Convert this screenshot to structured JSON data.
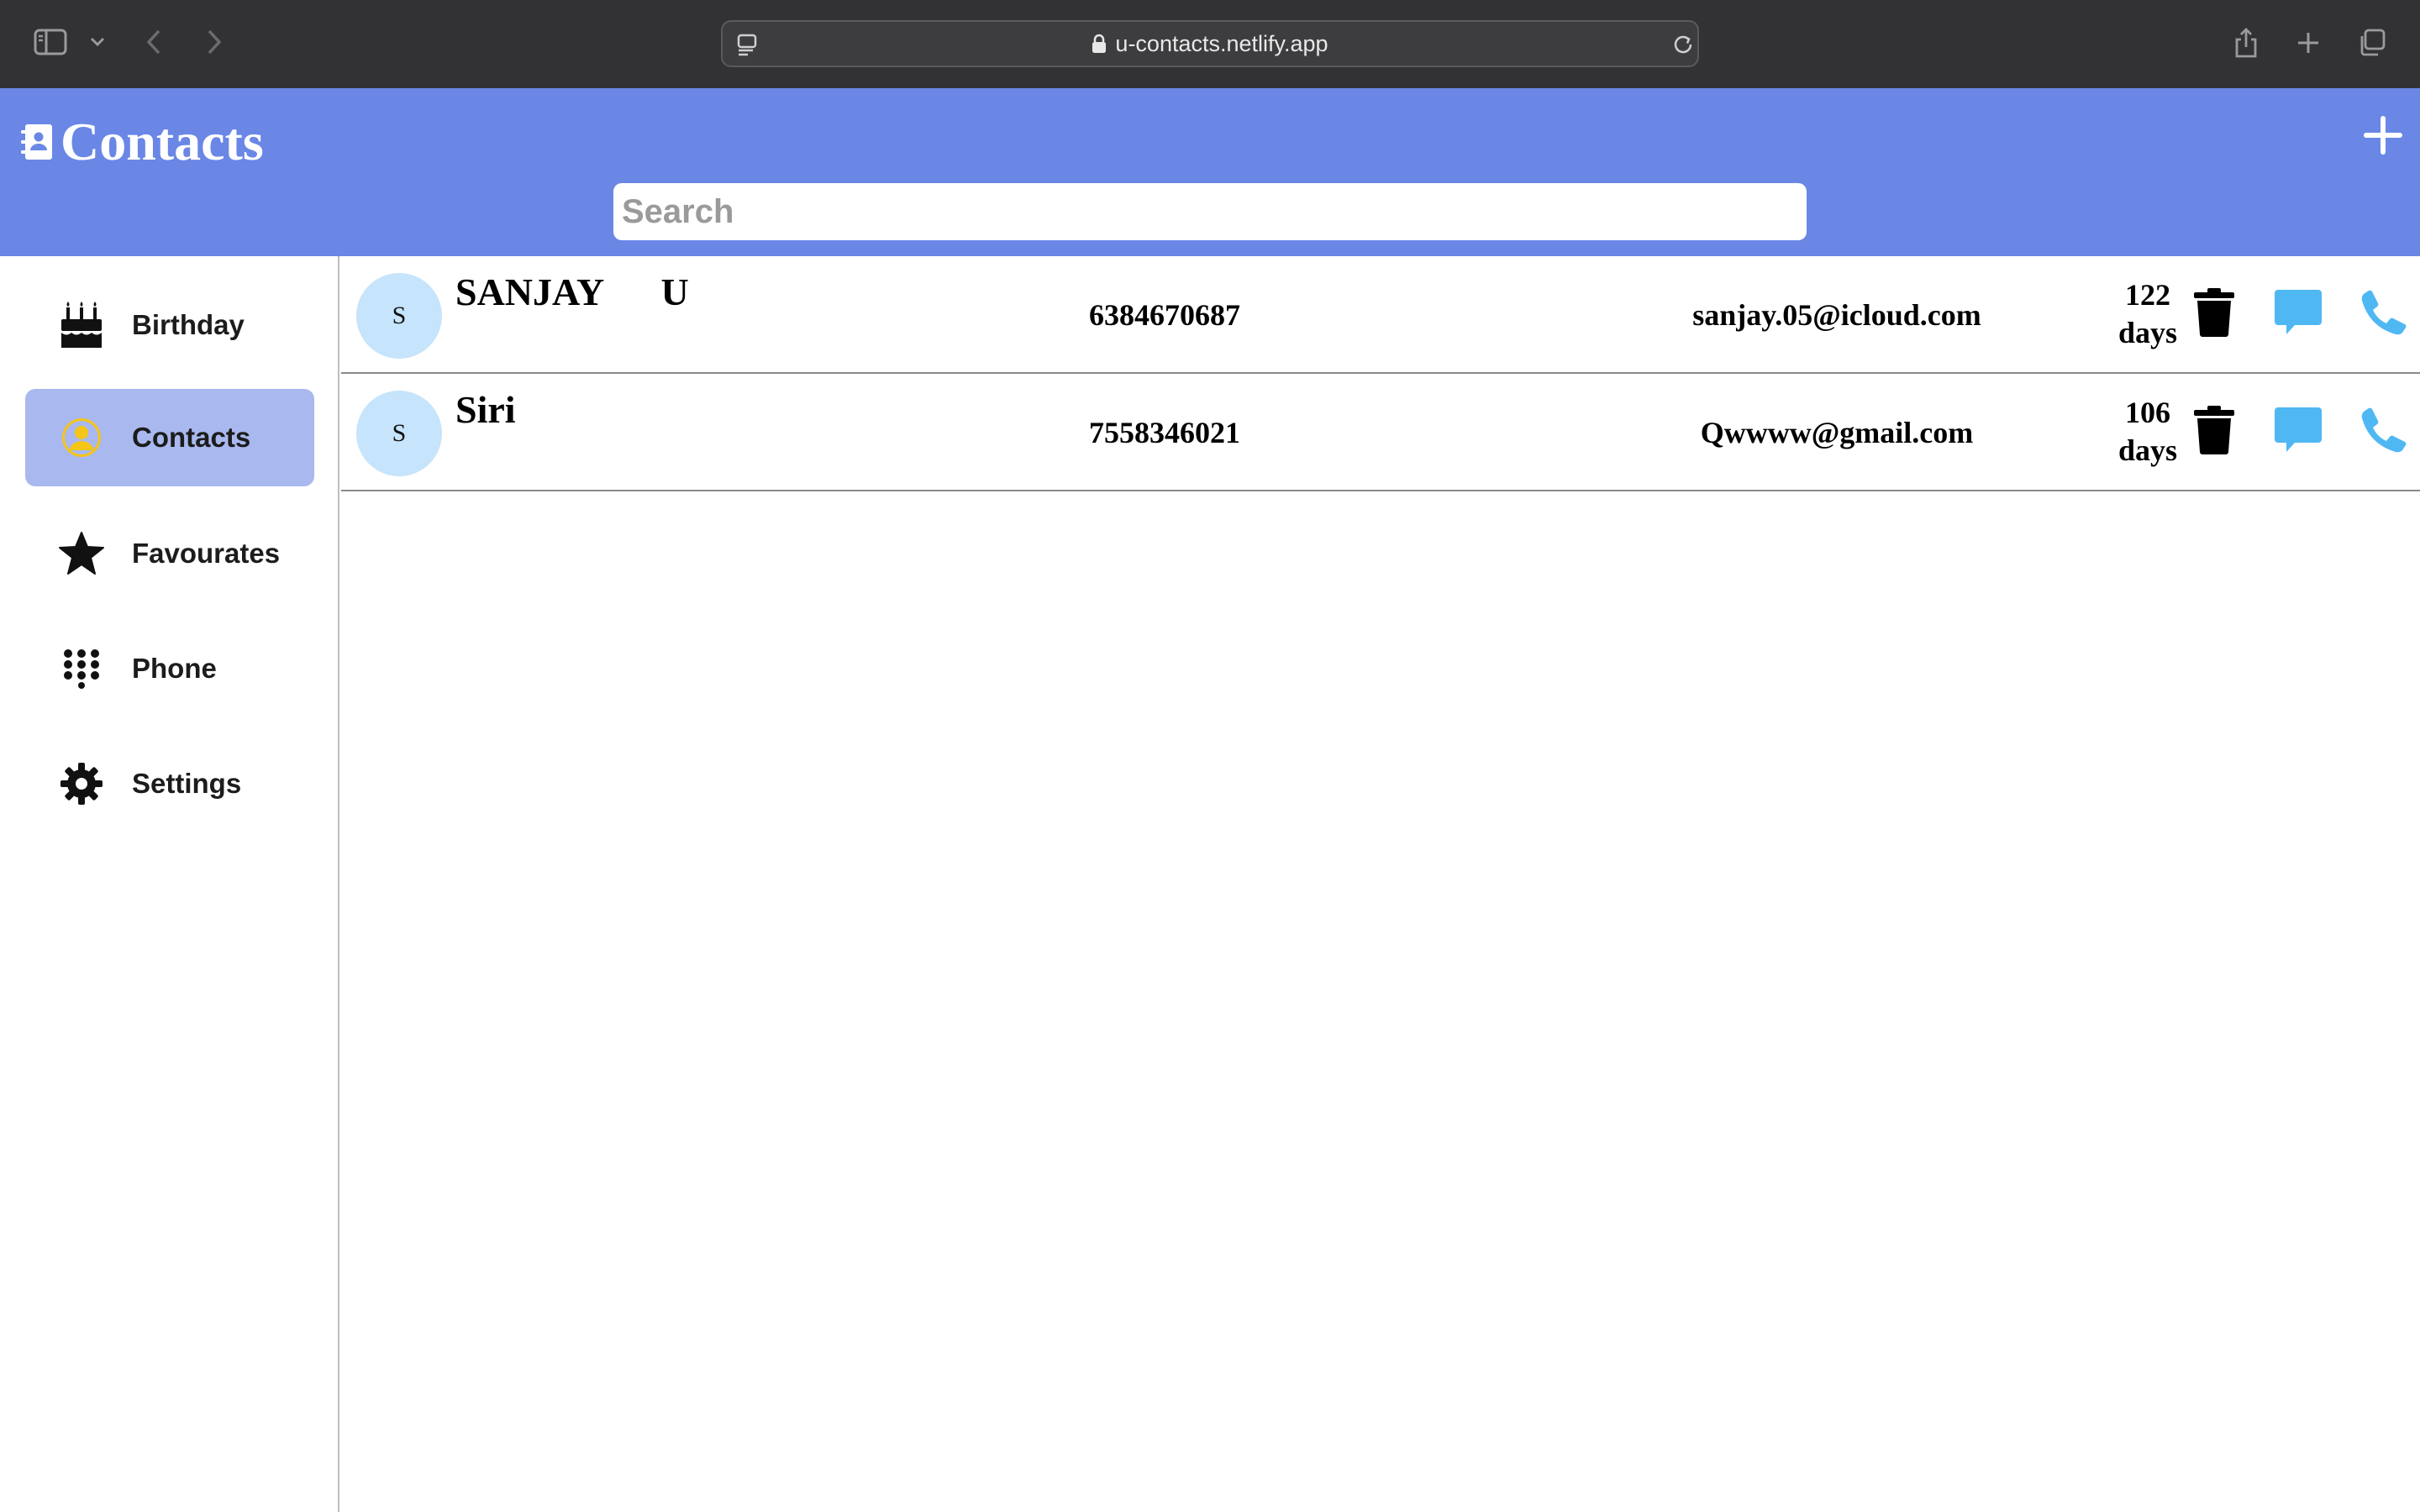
{
  "browser": {
    "url": "u-contacts.netlify.app"
  },
  "header": {
    "title": "Contacts",
    "search_placeholder": "Search",
    "search_value": "",
    "accent_color": "#6a87e6"
  },
  "sidebar": {
    "items": [
      {
        "label": "Birthday",
        "icon": "birthday-cake-icon",
        "active": false
      },
      {
        "label": "Contacts",
        "icon": "user-circle-icon",
        "active": true
      },
      {
        "label": "Favourates",
        "icon": "star-icon",
        "active": false
      },
      {
        "label": "Phone",
        "icon": "dial-pad-icon",
        "active": false
      },
      {
        "label": "Settings",
        "icon": "gear-icon",
        "active": false
      }
    ],
    "active_color": "#a9b9ef"
  },
  "contacts": [
    {
      "initial": "S",
      "name": "SANJAY      U",
      "phone": "6384670687",
      "email": "sanjay.05@icloud.com",
      "days_num": "122",
      "days_unit": "days"
    },
    {
      "initial": "S",
      "name": "Siri",
      "phone": "7558346021",
      "email": "Qwwww@gmail.com",
      "days_num": "106",
      "days_unit": "days"
    }
  ],
  "actions": {
    "delete_icon": "trash-icon",
    "message_icon": "message-icon",
    "call_icon": "phone-icon",
    "action_color": "#4fb8f3"
  }
}
